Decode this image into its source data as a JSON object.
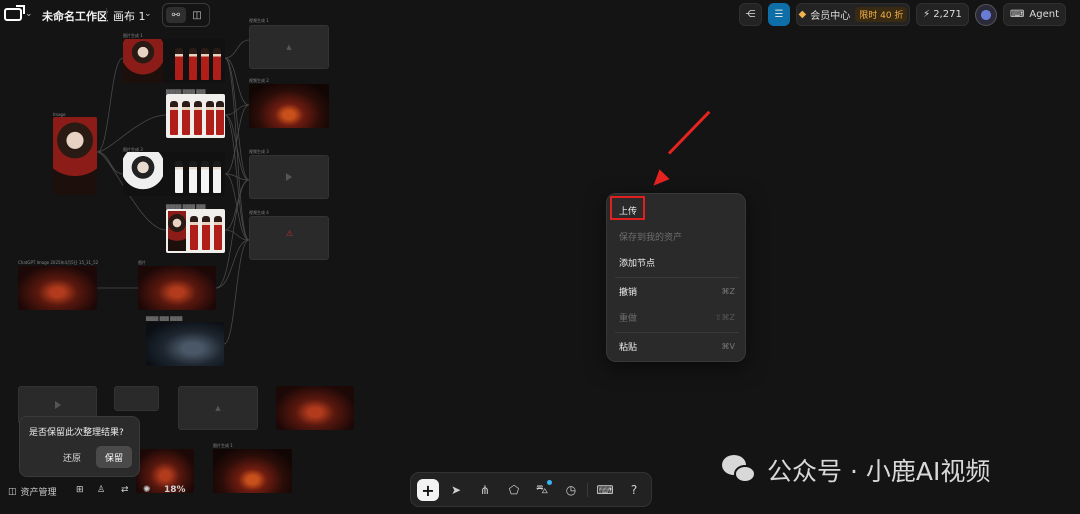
{
  "header": {
    "workspace_name": "未命名工作区",
    "canvas_name": "画布 1",
    "member_center": "会员中心",
    "promo_badge": "限时 40 折",
    "credits": "2,271",
    "agent_label": "Agent"
  },
  "canvas": {
    "nodes": [
      {
        "label": "Image",
        "kind": "image"
      },
      {
        "label": "图片生成 1",
        "kind": "image"
      },
      {
        "label": "图片生成 2",
        "kind": "image"
      },
      {
        "label": "图片生成 3",
        "kind": "image"
      },
      {
        "label": "图片生成 4",
        "kind": "image"
      },
      {
        "label": "视频生成 1",
        "kind": "video"
      },
      {
        "label": "视频生成 2",
        "kind": "video"
      },
      {
        "label": "视频生成 3",
        "kind": "video"
      },
      {
        "label": "视频生成 4",
        "kind": "video"
      },
      {
        "label": "ChatGPT Image 2025年4月5日 15_31_52",
        "kind": "image"
      },
      {
        "label": "图片",
        "kind": "image"
      },
      {
        "label": "图片生成 1",
        "kind": "image"
      }
    ],
    "zoom": "18%"
  },
  "context_menu": {
    "items": [
      {
        "label": "上传",
        "shortcut": "",
        "disabled": false
      },
      {
        "label": "保存到我的资产",
        "shortcut": "",
        "disabled": true
      },
      {
        "label": "添加节点",
        "shortcut": "",
        "disabled": false
      },
      {
        "label": "撤销",
        "shortcut": "⌘Z",
        "disabled": false
      },
      {
        "label": "重做",
        "shortcut": "⇧⌘Z",
        "disabled": true
      },
      {
        "label": "粘贴",
        "shortcut": "⌘V",
        "disabled": false
      }
    ]
  },
  "keep_dialog": {
    "question": "是否保留此次整理结果?",
    "restore_label": "还原",
    "keep_label": "保留"
  },
  "bottom_left": {
    "assets_label": "资产管理",
    "zoom_label": "18%"
  },
  "watermark": {
    "text": "公众号 · 小鹿AI视频"
  },
  "colors": {
    "background": "#141414",
    "annotation_red": "#e52420",
    "accent_blue": "#3ab7f2",
    "vip_orange": "#f2b24c"
  }
}
